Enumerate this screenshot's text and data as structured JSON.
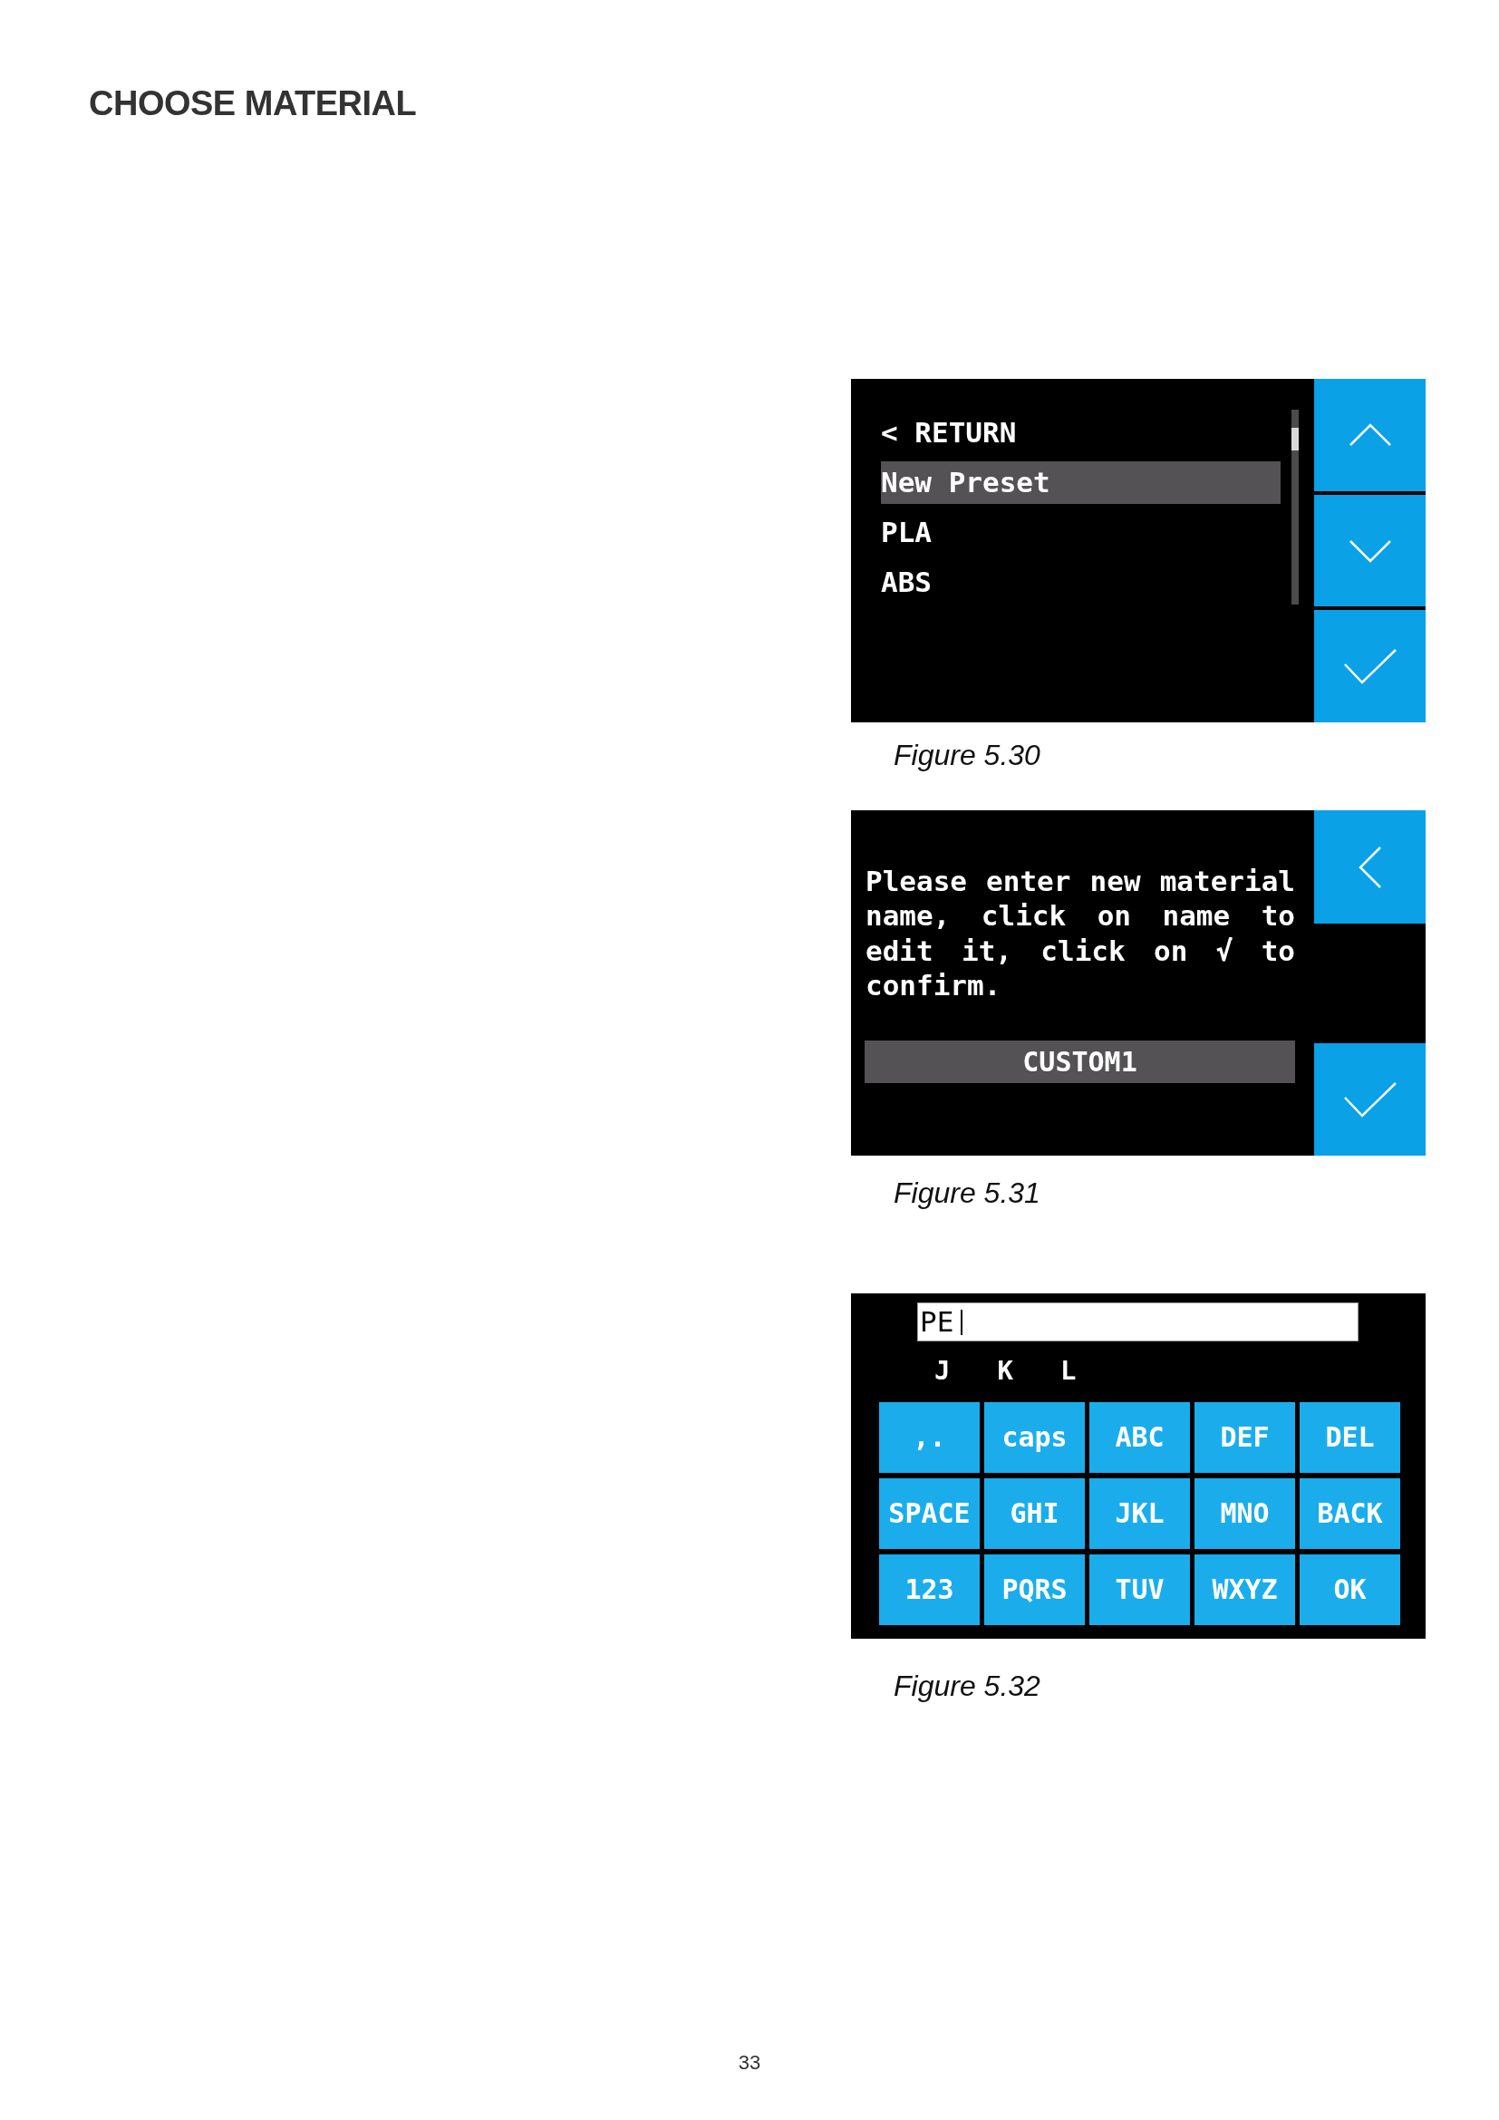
{
  "title": "CHOOSE MATERIAL",
  "figures": [
    {
      "kind": "material_list",
      "items": [
        {
          "label": "< RETURN",
          "selected": false
        },
        {
          "label": "New Preset",
          "selected": true
        },
        {
          "label": "PLA",
          "selected": false
        },
        {
          "label": "ABS",
          "selected": false
        }
      ],
      "caption": "Figure 5.30"
    },
    {
      "kind": "name_entry",
      "message": "Please enter new material name, click on name to edit it, click on √ to confirm.",
      "name_field": {
        "value": "CUSTOM1"
      },
      "caption": "Figure 5.31"
    },
    {
      "kind": "keyboard",
      "input": {
        "value": "PE"
      },
      "letter_choices": [
        "J",
        "K",
        "L"
      ],
      "keys": [
        [
          ",.",
          "caps",
          "ABC",
          "DEF",
          "DEL"
        ],
        [
          "SPACE",
          "GHI",
          "JKL",
          "MNO",
          "BACK"
        ],
        [
          "123",
          "PQRS",
          "TUV",
          "WXYZ",
          "OK"
        ]
      ],
      "caption": "Figure 5.32"
    }
  ],
  "page_number": "33"
}
